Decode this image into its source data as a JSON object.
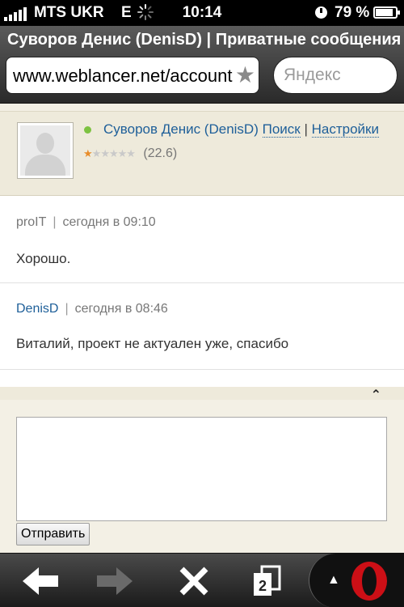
{
  "status_bar": {
    "carrier": "MTS UKR",
    "network": "E",
    "time": "10:14",
    "battery": "79 %"
  },
  "browser": {
    "page_title": "Суворов Денис (DenisD) | Приватные сообщения",
    "url": "www.weblancer.net/account",
    "search_placeholder": "Яндекс",
    "tab_count": "2"
  },
  "profile": {
    "name": "Суворов Денис (DenisD)",
    "search_link": "Поиск",
    "separator": "|",
    "settings_link": "Настройки",
    "rating_stars": 1,
    "rating_max": 6,
    "rating_score": "(22.6)",
    "online": true
  },
  "messages": [
    {
      "author": "proIT",
      "separator": "|",
      "time": "сегодня в 09:10",
      "text": "Хорошо."
    },
    {
      "author": "DenisD",
      "separator": "|",
      "time": "сегодня в 08:46",
      "text": "Виталий, проект не актуален уже, спасибо"
    }
  ],
  "reply": {
    "collapse_glyph": "⌃",
    "text_value": "",
    "send_label": "Отправить"
  },
  "colors": {
    "link": "#1e5f99",
    "online": "#7dc241",
    "star_on": "#e88d2a",
    "panel_bg": "#eeeadb",
    "opera_red": "#cc0f16"
  }
}
